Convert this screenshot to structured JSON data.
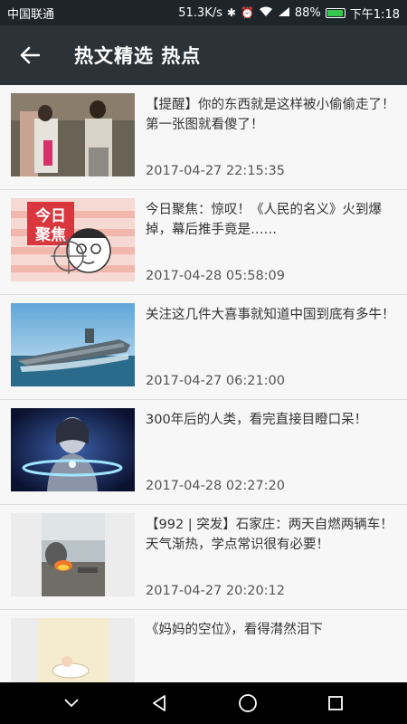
{
  "status_bar": {
    "carrier": "中国联通",
    "network_speed": "51.3K/s",
    "battery": "88%",
    "time": "下午1:18"
  },
  "header": {
    "title": "热文精选 热点",
    "back_icon": "arrow-left-icon"
  },
  "articles": [
    {
      "title": "【提醒】你的东西就是这样被小偷偷走了！第一张图就看傻了！",
      "time": "2017-04-27 22:15:35"
    },
    {
      "title": "今日聚焦：惊叹！《人民的名义》火到爆掉，幕后推手竟是……",
      "time": "2017-04-28 05:58:09",
      "thumb_text_1": "今日",
      "thumb_text_2": "聚焦"
    },
    {
      "title": "关注这几件大喜事就知道中国到底有多牛！",
      "time": "2017-04-27 06:21:00"
    },
    {
      "title": "300年后的人类，看完直接目瞪口呆！",
      "time": "2017-04-28 02:27:20"
    },
    {
      "title": "【992 | 突发】石家庄：两天自燃两辆车！天气渐热，学点常识很有必要！",
      "time": "2017-04-27 20:20:12"
    },
    {
      "title": "《妈妈的空位》，看得潸然泪下",
      "time": ""
    }
  ],
  "nav_bar": {
    "buttons": [
      "chevron-down-icon",
      "back-triangle-icon",
      "home-circle-icon",
      "recents-square-icon"
    ]
  }
}
